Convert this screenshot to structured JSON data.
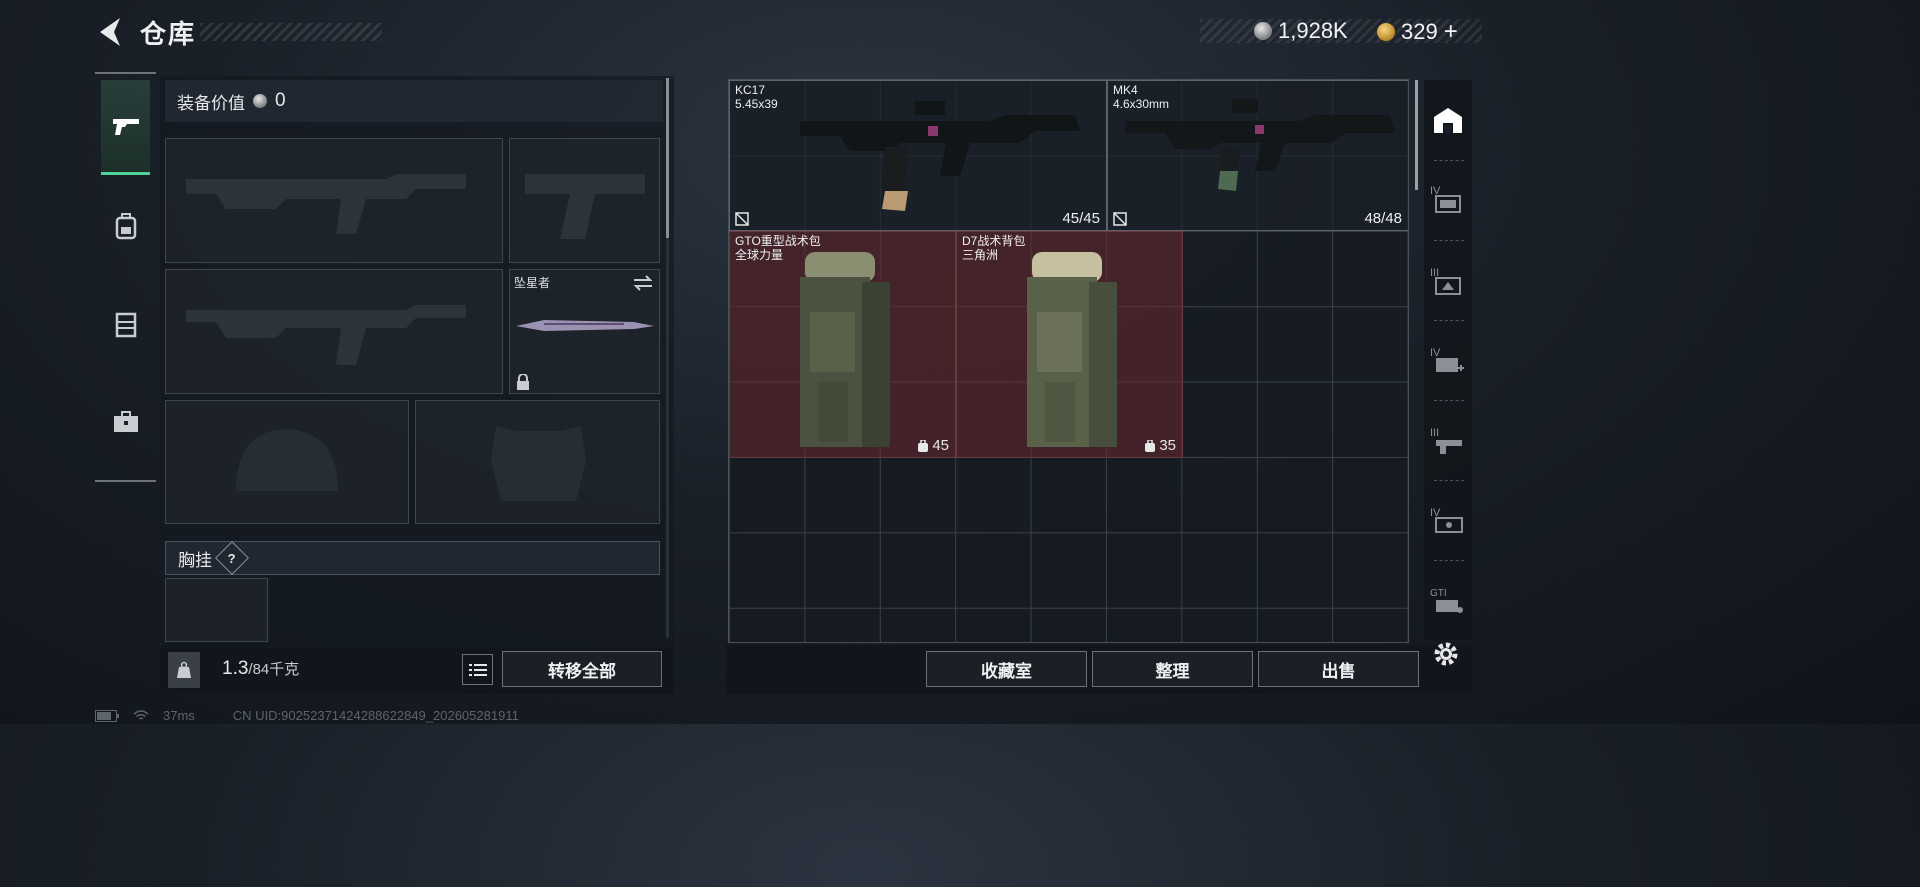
{
  "header": {
    "title": "仓库"
  },
  "currency": {
    "silver": {
      "value": "1,928K",
      "icon": "silver-coin-icon"
    },
    "gold": {
      "value": "329",
      "add": "+",
      "icon": "gold-coin-icon"
    }
  },
  "equipment": {
    "value_label": "装备价值",
    "value": "0",
    "melee_name": "坠星者",
    "chest_label": "胸挂",
    "help": "?",
    "weight_value": "1.3",
    "weight_max": "/84千克",
    "transfer_all": "转移全部"
  },
  "stash": {
    "items": [
      {
        "name": "KC17",
        "sub": "5.45x39",
        "count": "45/45"
      },
      {
        "name": "MK4",
        "sub": "4.6x30mm",
        "count": "48/48"
      },
      {
        "name": "GTO重型战术包",
        "sub": "全球力量",
        "capacity": "45"
      },
      {
        "name": "D7战术背包",
        "sub": "三角洲",
        "capacity": "35"
      }
    ],
    "buttons": {
      "collection": "收藏室",
      "sort": "整理",
      "sell": "出售"
    }
  },
  "filter_rail": [
    "all",
    "IV",
    "III",
    "IV",
    "III",
    "IV",
    "GTI"
  ],
  "status": {
    "ping": "37ms",
    "uid": "CN UID:9025237142428862284​9_202605281911"
  },
  "colors": {
    "accent": "#4fd19a",
    "bag_bg": "#692830"
  }
}
